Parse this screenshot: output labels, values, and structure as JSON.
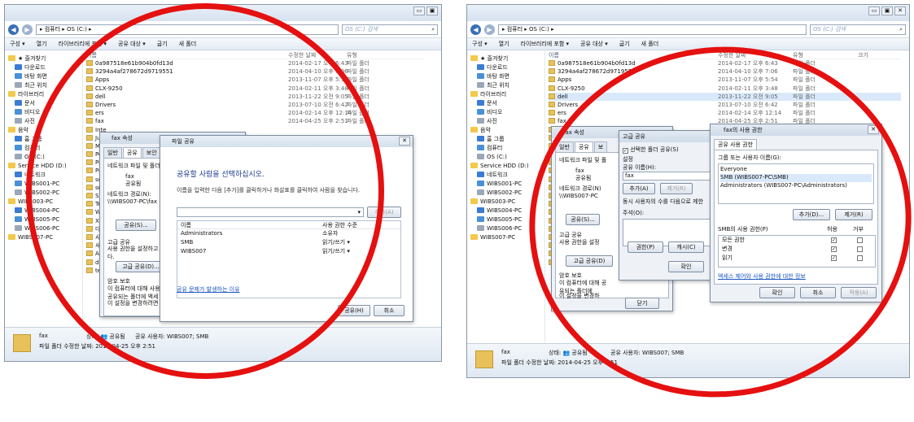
{
  "left": {
    "address": "▸ 컴퓨터 ▸ OS (C:) ▸",
    "search": "OS (C:) 검색",
    "toolbar": [
      "구성 ▾",
      "열기",
      "라이브러리에 포함 ▾",
      "공유 대상 ▾",
      "굽기",
      "새 폴더"
    ],
    "nav": [
      "★ 즐겨찾기",
      "다운로드",
      "바탕 화면",
      "최근 위치",
      "라이브러리",
      "문서",
      "비디오",
      "사진",
      "음악",
      "홈 그룹",
      "컴퓨터",
      "OS (C:)",
      "Service HDD (D:)",
      "네트워크",
      "WIBS001-PC",
      "WIBS002-PC",
      "WIBS003-PC",
      "WIBS004-PC",
      "WIBS005-PC",
      "WIBS006-PC",
      "WIBS007-PC"
    ],
    "head": {
      "name": "이름",
      "date": "수정한 날짜",
      "type": "유형"
    },
    "files": [
      {
        "n": "0a987518e61b904b0fd13d",
        "d": "2014-02-17 오후 6:43",
        "t": "파일 폴더"
      },
      {
        "n": "3294a4af278672d9719551",
        "d": "2014-04-10 오후 7:06",
        "t": "파일 폴더"
      },
      {
        "n": "Apps",
        "d": "2013-11-07 오후 5:54",
        "t": "파일 폴더"
      },
      {
        "n": "CLX-9250",
        "d": "2014-02-11 오후 3:48",
        "t": "파일 폴더"
      },
      {
        "n": "dell",
        "d": "2013-11-22 오전 9:05",
        "t": "파일 폴더"
      },
      {
        "n": "Drivers",
        "d": "2013-07-10 오전 6:42",
        "t": "파일 폴더"
      },
      {
        "n": "ers",
        "d": "2014-02-14 오후 12:14",
        "t": "파일 폴더"
      },
      {
        "n": "fax",
        "d": "2014-04-25 오후 2:51",
        "t": "파일 폴더"
      },
      {
        "n": "Inte",
        "d": "",
        "t": ""
      },
      {
        "n": "Jung",
        "d": "",
        "t": ""
      },
      {
        "n": "MSO",
        "d": "",
        "t": ""
      },
      {
        "n": "Perf",
        "d": "",
        "t": ""
      },
      {
        "n": "Prog",
        "d": "",
        "t": ""
      },
      {
        "n": "Prog",
        "d": "",
        "t": ""
      },
      {
        "n": "scx-",
        "d": "",
        "t": ""
      },
      {
        "n": "smb",
        "d": "",
        "t": ""
      },
      {
        "n": "SMB",
        "d": "",
        "t": ""
      },
      {
        "n": "Tem",
        "d": "",
        "t": ""
      },
      {
        "n": "Win",
        "d": "",
        "t": ""
      },
      {
        "n": "Xecu",
        "d": "",
        "t": ""
      },
      {
        "n": "다운",
        "d": "",
        "t": ""
      },
      {
        "n": "사용",
        "d": "",
        "t": ""
      },
      {
        "n": "새 폴",
        "d": "",
        "t": ""
      },
      {
        "n": "Aut",
        "d": "",
        "t": ""
      },
      {
        "n": "dell",
        "d": "",
        "t": ""
      },
      {
        "n": "tem",
        "d": "",
        "t": ""
      }
    ],
    "status": {
      "name": "fax",
      "line1": "상태: 👥 공유됨",
      "line1b": "공유 사용자: WIBS007; SMB",
      "line2": "파일 폴더  수정한 날짜: 2014-04-25 오후 2:51"
    },
    "props": {
      "title": "fax 속성",
      "tabs": [
        "일반",
        "공유",
        "보안"
      ],
      "section": "네트워크 파일 및 폴더",
      "folder": "fax",
      "state": "공유됨",
      "pathlabel": "네트워크 경로(N):",
      "path": "\\\\WIBS007-PC\\fax",
      "share": "공유(S)...",
      "adv": "고급 공유",
      "advdesc": "사용 권한을 설정하고 다.",
      "advbtn": "고급 공유(D)...",
      "pw": "암호 보호",
      "pwdesc": "이 컴퓨터에 대해 사용자 공유되는 폴더에 액세",
      "pwchange": "이 설정을 변경하려면",
      "close": "닫기"
    },
    "share": {
      "title": "파일 공유",
      "heading": "공유할 사람을 선택하십시오.",
      "desc": "이름을 입력한 다음 [추가]를 클릭하거나 화살표를 클릭하여 사람을 찾습니다.",
      "add": "추가(A)",
      "cols": [
        "이름",
        "사용 권한 수준"
      ],
      "rows": [
        {
          "n": "Administrators",
          "p": "소유자"
        },
        {
          "n": "SMB",
          "p": "읽기/쓰기 ▾"
        },
        {
          "n": "WIBS007",
          "p": "읽기/쓰기 ▾"
        }
      ],
      "trouble": "공유 문제가 발생하는 이유",
      "ok": "공유(H)",
      "cancel": "취소"
    }
  },
  "right": {
    "address": "▸ 컴퓨터 ▸ OS (C:) ▸",
    "search": "OS (C:) 검색",
    "toolbar": [
      "구성 ▾",
      "열기",
      "라이브러리에 포함 ▾",
      "공유 대상 ▾",
      "굽기",
      "새 폴더"
    ],
    "nav": [
      "★ 즐겨찾기",
      "다운로드",
      "바탕 화면",
      "최근 위치",
      "라이브러리",
      "문서",
      "비디오",
      "사진",
      "음악",
      "홈 그룹",
      "컴퓨터",
      "OS (C:)",
      "Service HDD (D:)",
      "네트워크",
      "WIBS001-PC",
      "WIBS002-PC",
      "WIBS003-PC",
      "WIBS004-PC",
      "WIBS005-PC",
      "WIBS006-PC",
      "WIBS007-PC"
    ],
    "head": {
      "name": "이름",
      "date": "수정한 날짜",
      "type": "유형",
      "size": "크기"
    },
    "files": [
      {
        "n": "0a987518e61b904b0fd13d",
        "d": "2014-02-17 오후 6:43",
        "t": "파일 폴더"
      },
      {
        "n": "3294a4af278672d9719551",
        "d": "2014-04-10 오후 7:06",
        "t": "파일 폴더"
      },
      {
        "n": "Apps",
        "d": "2013-11-07 오후 5:54",
        "t": "파일 폴더"
      },
      {
        "n": "CLX-9250",
        "d": "2014-02-11 오후 3:48",
        "t": "파일 폴더"
      },
      {
        "n": "dell",
        "d": "2013-11-22 오전 9:05",
        "t": "파일 폴더"
      },
      {
        "n": "Drivers",
        "d": "2013-07-10 오전 6:42",
        "t": "파일 폴더"
      },
      {
        "n": "ers",
        "d": "2014-02-14 오후 12:14",
        "t": "파일 폴더"
      },
      {
        "n": "fax",
        "d": "2014-04-25 오후 2:51",
        "t": "파일 폴더"
      },
      {
        "n": "Inte",
        "d": "",
        "t": ""
      },
      {
        "n": "MSO",
        "d": "",
        "t": ""
      },
      {
        "n": "Perf",
        "d": "",
        "t": ""
      },
      {
        "n": "Prog",
        "d": "",
        "t": ""
      },
      {
        "n": "Prog",
        "d": "",
        "t": ""
      },
      {
        "n": "scx-",
        "d": "",
        "t": ""
      },
      {
        "n": "smb",
        "d": "",
        "t": ""
      },
      {
        "n": "SMB",
        "d": "",
        "t": ""
      },
      {
        "n": "Tem",
        "d": "",
        "t": ""
      },
      {
        "n": "Win",
        "d": "",
        "t": ""
      },
      {
        "n": "Xecu",
        "d": "",
        "t": ""
      },
      {
        "n": "다운",
        "d": "",
        "t": ""
      },
      {
        "n": "사용",
        "d": "",
        "t": ""
      },
      {
        "n": "새 폴",
        "d": "",
        "t": ""
      },
      {
        "n": "Aut",
        "d": "",
        "t": ""
      },
      {
        "n": "dell",
        "d": "",
        "t": ""
      },
      {
        "n": "tem",
        "d": "",
        "t": ""
      }
    ],
    "status": {
      "name": "fax",
      "line1": "상태: 👥 공유됨",
      "line1b": "공유 사용자: WIBS007; SMB",
      "line2": "파일 폴더  수정한 날짜: 2014-04-25 오후 2:51"
    },
    "props": {
      "title": "fax 속성",
      "tabs": [
        "일반",
        "공유",
        "보"
      ],
      "section": "네트워크 파일 및 폴",
      "folder": "fax",
      "state": "공유됨",
      "pathlabel": "네트워크 경로(N)",
      "path": "\\\\WIBS007-PC",
      "share": "공유(S)...",
      "adv": "고급 공유",
      "advdesc": "사용 권한을 설정",
      "advbtn": "고급 공유(D)",
      "pw": "암호 보호",
      "pwdesc": "이 컴퓨터에 대해 공유되는 폴더에",
      "pwchange": "이 설정을 변경하",
      "close": "닫기",
      "cancel": "취소"
    },
    "adv": {
      "title": "고급 공유",
      "check": "선택한 폴더 공유(S)",
      "setting": "설정",
      "namelabel": "공유 이름(H):",
      "name": "fax",
      "add": "추가(A)",
      "remove": "제거(R)",
      "limit": "동시 사용자의 수를 다음으로 제한",
      "comment": "주석(O):",
      "perm": "권한(P)",
      "cache": "캐시(C)",
      "ok": "확인"
    },
    "perm": {
      "title": "fax의 사용 권한",
      "tab": "공유 사용 권한",
      "grouplabel": "그룹 또는 사용자 이름(G):",
      "users": [
        "Everyone",
        "SMB (WIBS007-PC\\SMB)",
        "Administrators (WIBS007-PC\\Administrators)"
      ],
      "add": "추가(D)...",
      "remove": "제거(R)",
      "permlabel": "SMB의 사용 권한(P)",
      "allow": "허용",
      "deny": "거부",
      "perms": [
        "모든 권한",
        "변경",
        "읽기"
      ],
      "link": "액세스 제어와 사용 권한에 대한 정보",
      "ok": "확인",
      "cancel": "취소",
      "apply": "적용(A)"
    }
  }
}
